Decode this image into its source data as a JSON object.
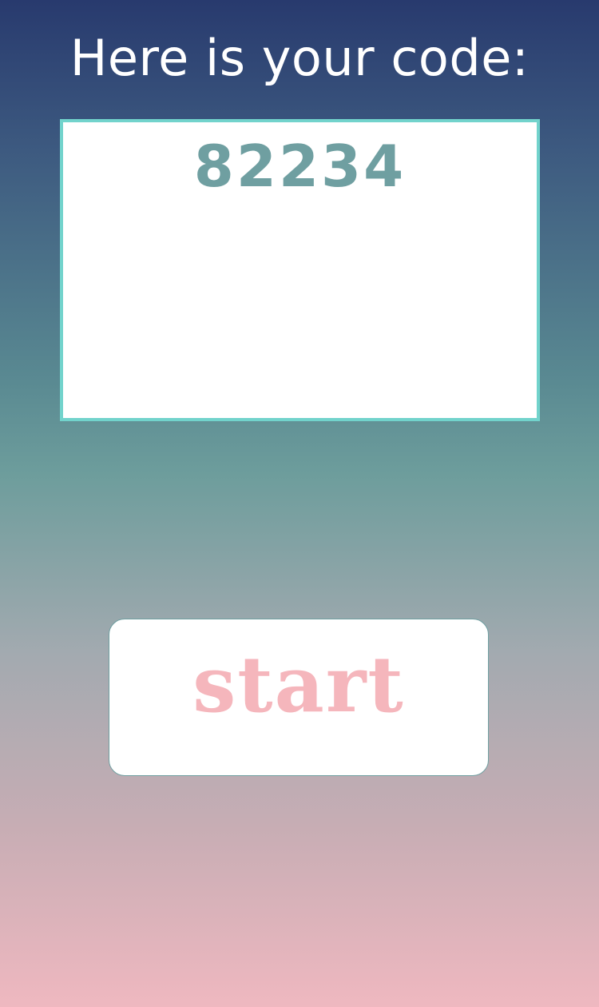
{
  "heading": "Here is your code:",
  "code": {
    "value": "82234"
  },
  "start_button": {
    "label": "start"
  },
  "colors": {
    "background_top": "#283a6e",
    "background_middle": "#6d9d9c",
    "background_bottom": "#efb8c0",
    "code_border": "#72d3cc",
    "code_text": "#6f9fa1",
    "button_text": "#f5b6bc"
  }
}
